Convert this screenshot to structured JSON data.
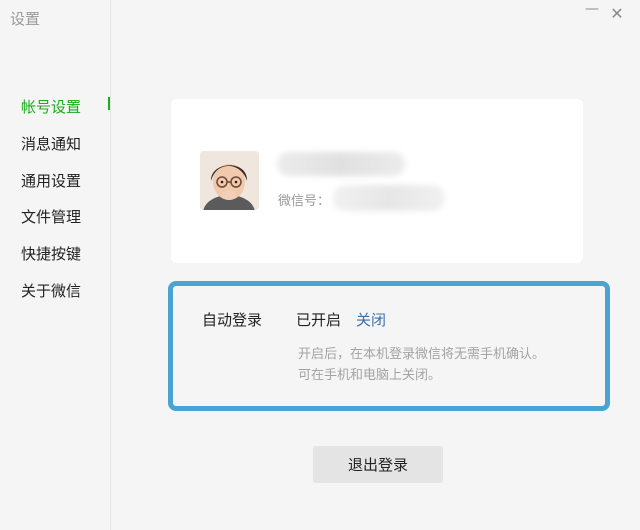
{
  "window": {
    "title": "设置",
    "minimize_glyph": "—",
    "close_glyph": "✕"
  },
  "sidebar": {
    "items": [
      {
        "label": "帐号设置",
        "active": true
      },
      {
        "label": "消息通知",
        "active": false
      },
      {
        "label": "通用设置",
        "active": false
      },
      {
        "label": "文件管理",
        "active": false
      },
      {
        "label": "快捷按键",
        "active": false
      },
      {
        "label": "关于微信",
        "active": false
      }
    ],
    "active_color": "#1aad19"
  },
  "profile": {
    "avatar_icon": "user-avatar-photo",
    "wechat_id_label": "微信号："
  },
  "auto_login": {
    "label": "自动登录",
    "status": "已开启",
    "toggle_label": "关闭",
    "description_line1": "开启后，在本机登录微信将无需手机确认。",
    "description_line2": "可在手机和电脑上关闭。",
    "highlight_color": "#4aa3d2"
  },
  "logout": {
    "label": "退出登录"
  }
}
